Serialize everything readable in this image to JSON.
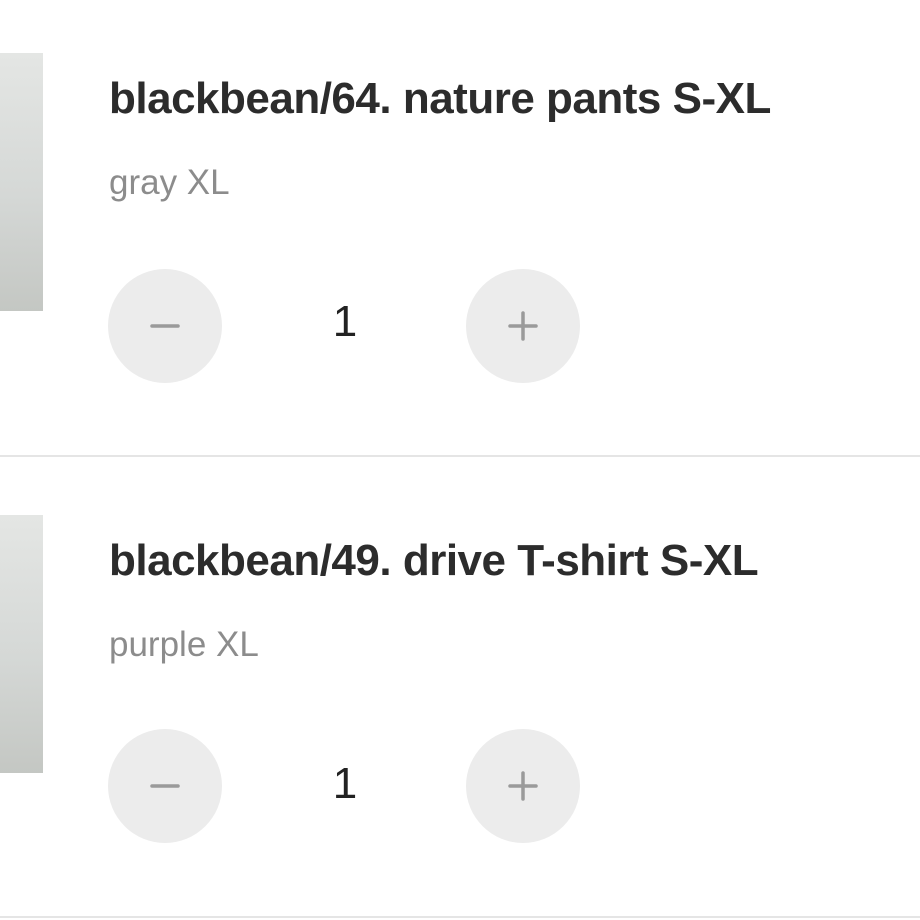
{
  "cart": {
    "items": [
      {
        "title": "blackbean/64. nature pants S-XL",
        "variant": "gray XL",
        "quantity": "1",
        "minus_icon": "minus-icon",
        "plus_icon": "plus-icon"
      },
      {
        "title": "blackbean/49. drive T-shirt S-XL",
        "variant": "purple XL",
        "quantity": "1",
        "minus_icon": "minus-icon",
        "plus_icon": "plus-icon"
      }
    ]
  },
  "colors": {
    "title": "#2c2c2c",
    "variant": "#8c8c8c",
    "button_bg": "#ececec",
    "icon": "#9a9a9a",
    "divider": "#e5e5e5"
  }
}
